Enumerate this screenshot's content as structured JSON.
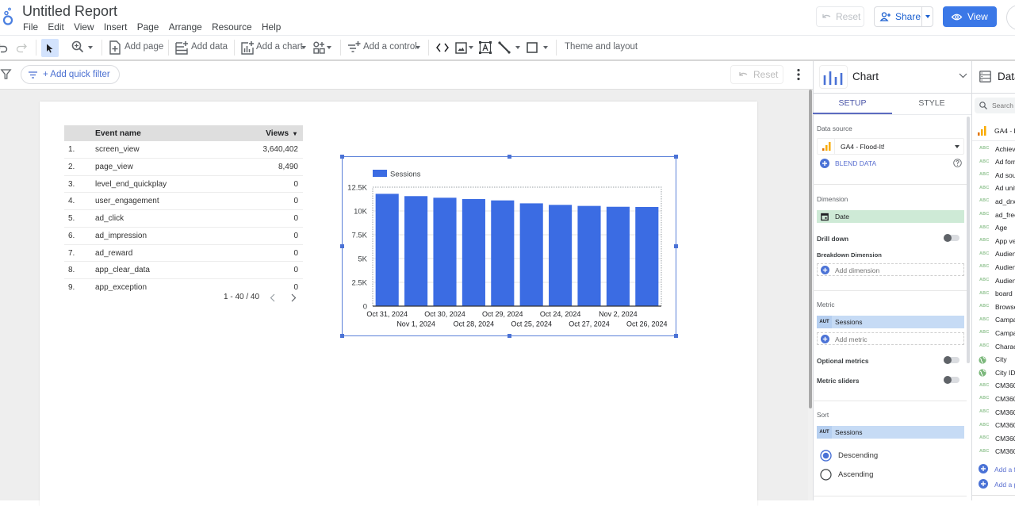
{
  "header": {
    "title": "Untitled Report",
    "menu": [
      "File",
      "Edit",
      "View",
      "Insert",
      "Page",
      "Arrange",
      "Resource",
      "Help"
    ],
    "reset_label": "Reset",
    "share_label": "Share",
    "view_label": "View",
    "accent_color": "#3b78e7"
  },
  "toolbar": {
    "add_page": "Add page",
    "add_data": "Add data",
    "add_chart": "Add a chart",
    "add_control": "Add a control",
    "theme_layout": "Theme and layout",
    "active_tool": "select-pointer"
  },
  "filter_bar": {
    "quick_filter_label": "+ Add quick filter",
    "reset_label": "Reset"
  },
  "table": {
    "columns": [
      "Event name",
      "Views"
    ],
    "sort_indicator": "▾",
    "rows": [
      {
        "index": "1.",
        "event_name": "screen_view",
        "views": "3,640,402"
      },
      {
        "index": "2.",
        "event_name": "page_view",
        "views": "8,490"
      },
      {
        "index": "3.",
        "event_name": "level_end_quickplay",
        "views": "0"
      },
      {
        "index": "4.",
        "event_name": "user_engagement",
        "views": "0"
      },
      {
        "index": "5.",
        "event_name": "ad_click",
        "views": "0"
      },
      {
        "index": "6.",
        "event_name": "ad_impression",
        "views": "0"
      },
      {
        "index": "7.",
        "event_name": "ad_reward",
        "views": "0"
      },
      {
        "index": "8.",
        "event_name": "app_clear_data",
        "views": "0"
      },
      {
        "index": "9.",
        "event_name": "app_exception",
        "views": "0"
      }
    ],
    "pagination": "1 - 40 / 40"
  },
  "chart_data": {
    "type": "bar",
    "title": "",
    "xlabel": "",
    "ylabel": "",
    "legend_position": "top-left",
    "grid": true,
    "categories": [
      "Oct 31, 2024",
      "Nov 1, 2024",
      "Oct 30, 2024",
      "Oct 28, 2024",
      "Oct 29, 2024",
      "Oct 25, 2024",
      "Oct 24, 2024",
      "Oct 27, 2024",
      "Nov 2, 2024",
      "Oct 26, 2024"
    ],
    "series": [
      {
        "name": "Sessions",
        "color": "#3b6ce3",
        "values": [
          11800,
          11560,
          11390,
          11250,
          11110,
          10800,
          10640,
          10530,
          10440,
          10420
        ]
      }
    ],
    "ylim": [
      0,
      12500
    ],
    "y_ticks": [
      {
        "value": 0,
        "label": "0"
      },
      {
        "value": 2500,
        "label": "2.5K"
      },
      {
        "value": 5000,
        "label": "5K"
      },
      {
        "value": 7500,
        "label": "7.5K"
      },
      {
        "value": 10000,
        "label": "10K"
      },
      {
        "value": 12500,
        "label": "12.5K"
      }
    ]
  },
  "chart_panel": {
    "title": "Chart",
    "tabs": [
      "SETUP",
      "STYLE"
    ],
    "active_tab": "SETUP",
    "data_source": {
      "label": "Data source",
      "value": "GA4 - Flood-It!",
      "blend_label": "BLEND DATA"
    },
    "dimension": {
      "label": "Dimension",
      "value": "Date"
    },
    "drill_down": {
      "label": "Drill down",
      "enabled": false
    },
    "breakdown": {
      "label": "Breakdown Dimension",
      "add_label": "Add dimension"
    },
    "metric": {
      "label": "Metric",
      "aggregation": "AUT",
      "value": "Sessions",
      "add_label": "Add metric"
    },
    "optional_metrics": {
      "label": "Optional metrics",
      "enabled": false
    },
    "metric_sliders": {
      "label": "Metric sliders",
      "enabled": false
    },
    "sort": {
      "label": "Sort",
      "aggregation": "AUT",
      "value": "Sessions",
      "options": [
        "Descending",
        "Ascending"
      ],
      "selected": "Descending"
    }
  },
  "data_panel": {
    "title": "Data",
    "search_placeholder": "Search",
    "source": "GA4 - F",
    "fields": [
      {
        "type": "ABC",
        "name": "Achiev"
      },
      {
        "type": "ABC",
        "name": "Ad form"
      },
      {
        "type": "ABC",
        "name": "Ad sou"
      },
      {
        "type": "ABC",
        "name": "Ad unit"
      },
      {
        "type": "ABC",
        "name": "ad_drx"
      },
      {
        "type": "ABC",
        "name": "ad_frec"
      },
      {
        "type": "ABC",
        "name": "Age"
      },
      {
        "type": "ABC",
        "name": "App ve"
      },
      {
        "type": "ABC",
        "name": "Audien"
      },
      {
        "type": "ABC",
        "name": "Audien"
      },
      {
        "type": "ABC",
        "name": "Audien"
      },
      {
        "type": "ABC",
        "name": "board"
      },
      {
        "type": "ABC",
        "name": "Browse"
      },
      {
        "type": "ABC",
        "name": "Campa"
      },
      {
        "type": "ABC",
        "name": "Campa"
      },
      {
        "type": "ABC",
        "name": "Charac"
      },
      {
        "type": "geo",
        "name": "City"
      },
      {
        "type": "geo",
        "name": "City ID"
      },
      {
        "type": "ABC",
        "name": "CM360"
      },
      {
        "type": "ABC",
        "name": "CM360"
      },
      {
        "type": "ABC",
        "name": "CM360"
      },
      {
        "type": "ABC",
        "name": "CM360"
      },
      {
        "type": "ABC",
        "name": "CM360"
      },
      {
        "type": "ABC",
        "name": "CM360"
      }
    ],
    "add_field": "Add a f",
    "add_parameter": "Add a p"
  }
}
